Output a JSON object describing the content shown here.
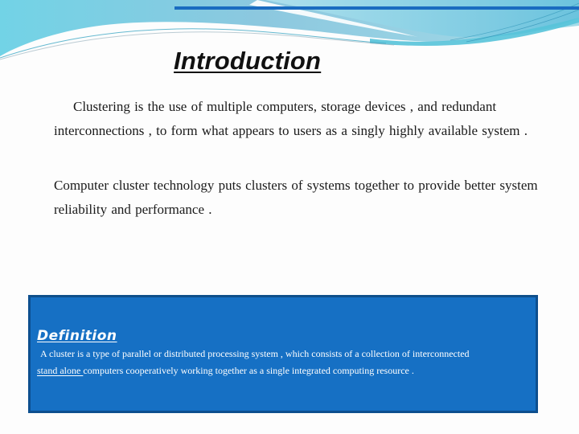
{
  "slide": {
    "title": "Introduction",
    "paragraphs": [
      "Clustering is the use of multiple computers, storage devices , and redundant interconnections , to form what appears to users as a  singly highly available system .",
      "Computer  cluster technology  puts  clusters of systems together to provide better system reliability and performance ."
    ],
    "definition": {
      "heading": "Definition",
      "line1": "A cluster is a type of parallel or distributed  processing system , which consists of a collection of  interconnected",
      "underlined_phrase": "stand alone ",
      "line2_rest": "computers cooperatively working together   as a single integrated computing resource ."
    }
  },
  "colors": {
    "accent_line": "#1a6cc0",
    "definition_fill": "#1670c4",
    "definition_border": "#0d4f8f",
    "wave_light": "#a8dcea",
    "wave_mid": "#6cc6e0",
    "title_text": "#111111"
  }
}
